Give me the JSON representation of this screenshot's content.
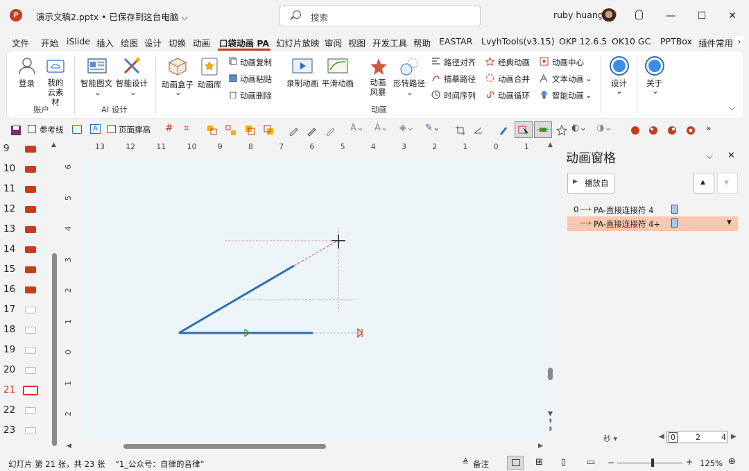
{
  "titlebar": {
    "app_icon": "P",
    "doc_title": "演示文稿2.pptx • 已保存到这台电脑 ⌵",
    "search_placeholder": "搜索",
    "user_name": "ruby huang",
    "minimize": "—",
    "maximize": "☐",
    "close": "✕"
  },
  "menu": {
    "tabs": [
      "文件",
      "开始",
      "iSlide",
      "插入",
      "绘图",
      "设计",
      "切换",
      "动画",
      "口袋动画 PA",
      "幻灯片放映",
      "审阅",
      "视图",
      "开发工具",
      "帮助",
      "EASTAR",
      "LvyhTools(v3.15)",
      "OKP 12.6.5",
      "OK10 GC",
      "PPTBox",
      "插件常用"
    ],
    "more": "›"
  },
  "ribbon": {
    "account": {
      "login": "登录",
      "cloud": "我的云素材",
      "group": "账户"
    },
    "ai": {
      "smart_text": "智能图文",
      "smart_design": "智能设计",
      "group": "AI 设计"
    },
    "anim": {
      "box": "动画盒子",
      "library": "动画库",
      "copy": "动画复制",
      "paste": "动画粘贴",
      "delete": "动画删除",
      "record": "录制动画",
      "smooth": "平滑动画",
      "style": "动画风暴",
      "shape_path": "形转路径",
      "path_align": "路径对齐",
      "trace_path": "描摹路径",
      "time_seq": "时间序列",
      "classic": "经典动画",
      "merge": "动画合并",
      "loop": "动画循环",
      "center": "动画中心",
      "text_anim": "文本动画",
      "smart_anim": "智能动画",
      "group": "动画"
    },
    "design": "设计",
    "about": "关于",
    "collapse": "⌵"
  },
  "toolbar2": {
    "guides": "参考线",
    "page_fit": "页面撑高",
    "more": "»"
  },
  "slides": {
    "numbers": [
      "9",
      "10",
      "11",
      "12",
      "13",
      "14",
      "15",
      "16",
      "17",
      "18",
      "19",
      "20",
      "21",
      "22",
      "23"
    ],
    "selected": "21"
  },
  "rulers": {
    "h": [
      "13",
      "12",
      "11",
      "10",
      "9",
      "8",
      "7",
      "6",
      "5",
      "4",
      "3",
      "2",
      "1",
      "0",
      "1"
    ],
    "v": [
      "6",
      "5",
      "4",
      "3",
      "2",
      "1",
      "0",
      "1",
      "2"
    ]
  },
  "anim_pane": {
    "title": "动画窗格",
    "play": "播放自",
    "items": [
      {
        "index": "0",
        "label": "PA-直接连接符 4"
      },
      {
        "index": "",
        "label": "PA-直接连接符 4+"
      }
    ],
    "seconds": "秒 ▾",
    "timeline": [
      "0",
      "2",
      "4"
    ]
  },
  "status": {
    "slide_info": "幻灯片 第 21 张，共 23 张",
    "theme": "“1_公众号：自律的音律”",
    "notes": "备注",
    "zoom": "125%"
  },
  "colors": {
    "accent": "#c43e1c",
    "line_blue": "#2a6ebb",
    "selected_row": "#f8c8b0",
    "canvas": "#eef5f9"
  }
}
